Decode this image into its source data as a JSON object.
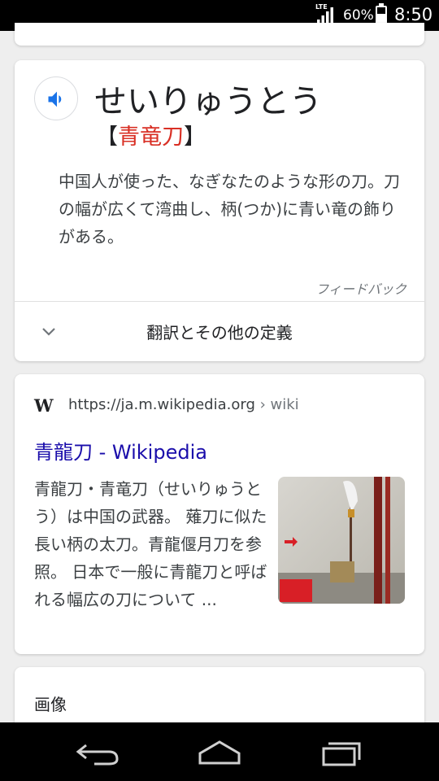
{
  "status_bar": {
    "network": "LTE",
    "battery_percent": "60%",
    "battery_level": 0.6,
    "time": "8:50"
  },
  "dictionary": {
    "reading": "せいりゅうとう",
    "kanji_open": "【",
    "kanji": "青竜刀",
    "kanji_close": "】",
    "definition": "中国人が使った、なぎなたのような形の刀。刀の幅が広くて湾曲し、柄(つか)に青い竜の飾りがある。",
    "feedback": "フィードバック",
    "expand_label": "翻訳とその他の定義",
    "speaker_icon": "speaker-icon",
    "accent_color": "#d93025"
  },
  "wiki_result": {
    "logo": "W",
    "url": "https://ja.m.wikipedia.org",
    "crumb": " › wiki",
    "title": "青龍刀 - Wikipedia",
    "snippet": "青龍刀・青竜刀（せいりゅうとう）は中国の武器。 薙刀に似た長い柄の太刀。青龍偃月刀を参照。 日本で一般に青龍刀と呼ばれる幅広の刀について ...",
    "link_color": "#1a0dab"
  },
  "images_section": {
    "label": "画像"
  },
  "nav_bar": {
    "back_icon": "back-icon",
    "home_icon": "home-icon",
    "recents_icon": "recents-icon"
  }
}
